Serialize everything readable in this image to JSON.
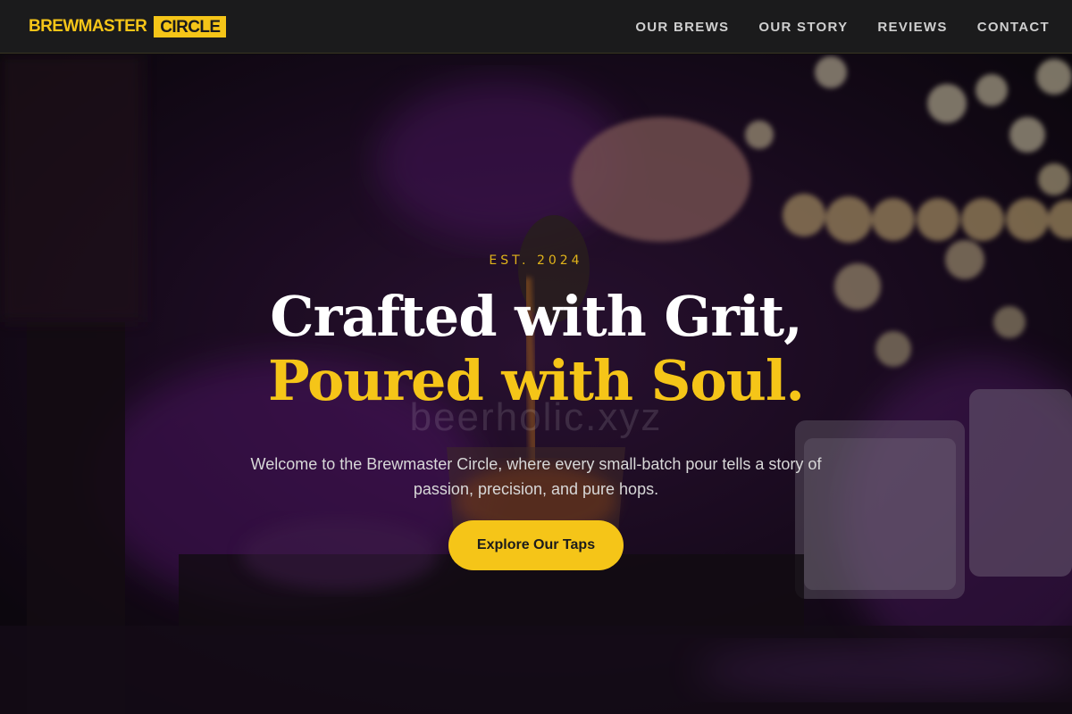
{
  "nav": {
    "brand_main": "BREWMASTER",
    "brand_tag": "CIRCLE",
    "links": [
      "OUR BREWS",
      "OUR STORY",
      "REVIEWS",
      "CONTACT"
    ]
  },
  "hero": {
    "eyebrow": "EST. 2024",
    "headline_line1": "Crafted with Grit,",
    "headline_line2": "Poured with Soul.",
    "watermark": "beerholic.xyz",
    "subtitle": "Welcome to the Brewmaster Circle, where every small-batch pour tells a story of passion, precision, and pure hops.",
    "cta_label": "Explore Our Taps"
  },
  "colors": {
    "accent": "#f5c518",
    "nav_bg": "#1b1b1c",
    "hero_tint": "#6a1c8a"
  }
}
